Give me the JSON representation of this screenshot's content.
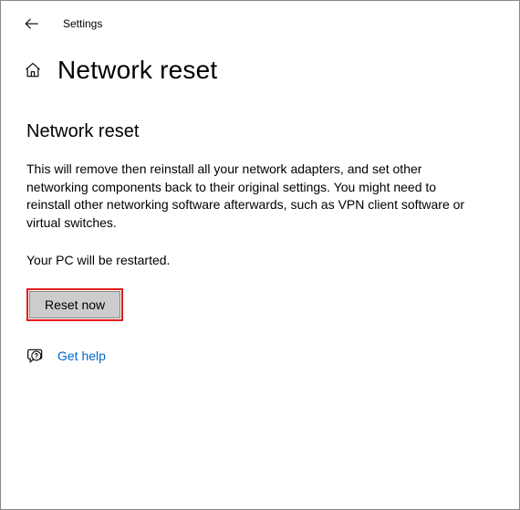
{
  "window": {
    "title": "Settings"
  },
  "header": {
    "title": "Network reset"
  },
  "content": {
    "section_title": "Network reset",
    "description": "This will remove then reinstall all your network adapters, and set other networking components back to their original settings. You might need to reinstall other networking software afterwards, such as VPN client software or virtual switches.",
    "restart_notice": "Your PC will be restarted.",
    "reset_button_label": "Reset now"
  },
  "help": {
    "label": "Get help"
  }
}
